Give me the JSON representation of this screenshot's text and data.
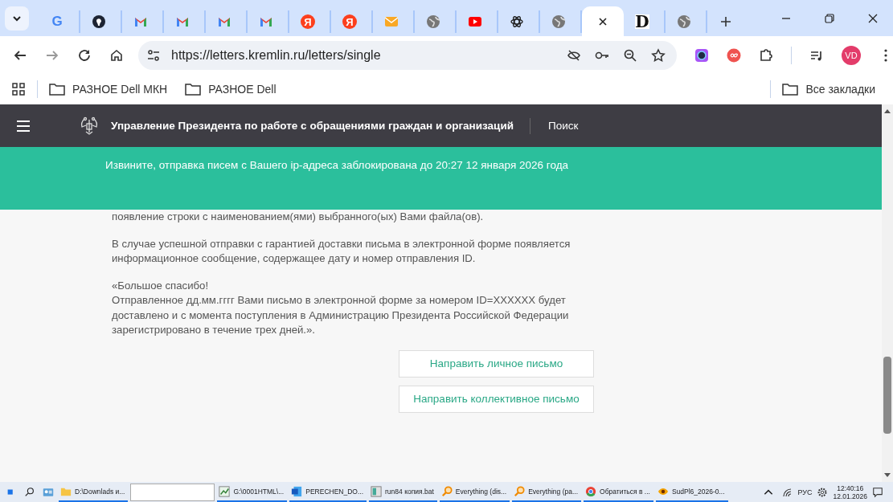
{
  "tabs": [
    {
      "kind": "google",
      "glyph": "G",
      "selected": false
    },
    {
      "kind": "dark",
      "selected": false
    },
    {
      "kind": "gmail",
      "selected": false
    },
    {
      "kind": "gmail",
      "selected": false
    },
    {
      "kind": "gmail",
      "selected": false
    },
    {
      "kind": "gmail",
      "selected": false
    },
    {
      "kind": "yandex",
      "glyph": "Я",
      "selected": false
    },
    {
      "kind": "yandex",
      "glyph": "Я",
      "selected": false
    },
    {
      "kind": "mail",
      "selected": false
    },
    {
      "kind": "globe",
      "selected": false
    },
    {
      "kind": "youtube",
      "selected": false
    },
    {
      "kind": "openai",
      "selected": false
    },
    {
      "kind": "globe",
      "selected": false
    },
    {
      "kind": "blank",
      "selected": true
    },
    {
      "kind": "letter",
      "glyph": "D",
      "selected": false
    },
    {
      "kind": "globe",
      "selected": false
    }
  ],
  "address_bar": {
    "url": "https://letters.kremlin.ru/letters/single"
  },
  "profile": {
    "initials": "VD"
  },
  "bookmarks": [
    {
      "label": "РАЗНОЕ Dell МКН"
    },
    {
      "label": "РАЗНОЕ Dell"
    }
  ],
  "all_bookmarks": "Все закладки",
  "site_header": {
    "title": "Управление Президента по работе с обращениями граждан и организаций",
    "search": "Поиск"
  },
  "banner": "Извините, отправка писем с Вашего ip-адреса заблокирована до 20:27 12 января 2026 года",
  "paragraphs": [
    [
      "появление строки с наименованием(ями) выбранного(ых) Вами файла(ов)."
    ],
    [
      "В случае успешной отправки с гарантией доставки письма в электронной форме появляется информационное сообщение, содержащее дату и номер отправления ID."
    ],
    [
      "«Большое спасибо!",
      "Отправленное дд.мм.гггг Вами письмо в электронной форме за номером ID=XXXXXX будет доставлено и с момента поступления в Администрацию Президента Российской Федерации зарегистрировано в течение трех дней.»."
    ]
  ],
  "buttons": [
    "Направить личное письмо",
    "Направить коллективное письмо"
  ],
  "taskbar": {
    "items": [
      {
        "kind": "folder",
        "label": "D:\\Downlads и..."
      },
      {
        "kind": "field"
      },
      {
        "kind": "chart",
        "label": "G:\\0001HTML\\..."
      },
      {
        "kind": "word",
        "label": "PERECHEN_DO..."
      },
      {
        "kind": "sheet",
        "label": "run84 копия.bat"
      },
      {
        "kind": "magnifier",
        "label": "Everything (dis..."
      },
      {
        "kind": "magnifier",
        "label": "Everything (pa..."
      },
      {
        "kind": "chrome",
        "label": "Обратиться в ..."
      },
      {
        "kind": "eye",
        "label": "SudPl6_2026-0..."
      }
    ],
    "language": "РУС",
    "time": "12:40:16",
    "date": "12.01.2026"
  }
}
